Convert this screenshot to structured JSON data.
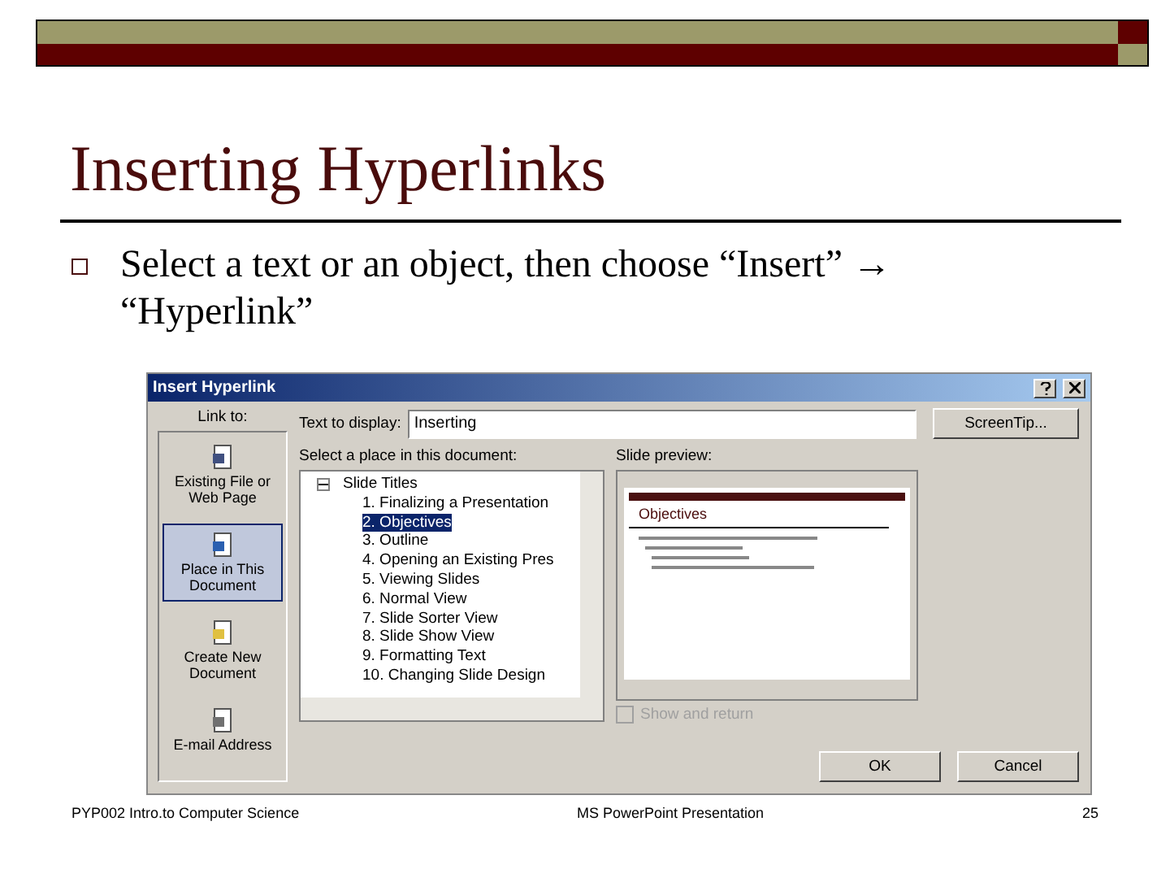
{
  "slide": {
    "title": "Inserting Hyperlinks",
    "bullets": [
      "Select a text or an object, then choose “Insert” → “Hyperlink”"
    ],
    "dialog": {
      "title": "Insert Hyperlink",
      "link_to_label": "Link to:",
      "link_to": [
        {
          "label": "Existing File or Web Page",
          "selected": false,
          "kind": "file"
        },
        {
          "label": "Place in This Document",
          "selected": true,
          "kind": "place"
        },
        {
          "label": "Create New Document",
          "selected": false,
          "kind": "new"
        },
        {
          "label": "E-mail Address",
          "selected": false,
          "kind": "mail"
        }
      ],
      "text_to_display_label": "Text to display:",
      "text_to_display": "Inserting",
      "screentip_button": "ScreenTip...",
      "tree_label": "Select a place in this document:",
      "tree": {
        "label": "Slide Titles",
        "expanded": true,
        "children": [
          {
            "label": "1. Finalizing a Presentation",
            "selected": false
          },
          {
            "label": "2. Objectives",
            "selected": true
          },
          {
            "label": "3. Outline",
            "selected": false
          },
          {
            "label": "4. Opening an Existing Pres",
            "selected": false
          },
          {
            "label": "5. Viewing Slides",
            "selected": false
          },
          {
            "label": "6. Normal View",
            "selected": false
          },
          {
            "label": "7. Slide Sorter View",
            "selected": false
          },
          {
            "label": "8. Slide Show View",
            "selected": false
          },
          {
            "label": "9. Formatting Text",
            "selected": false
          },
          {
            "label": "10. Changing Slide Design",
            "selected": false
          }
        ]
      },
      "preview_label": "Slide preview:",
      "preview_title": "Objectives",
      "show_and_return": {
        "label": "Show and return",
        "checked": false,
        "disabled": true
      },
      "buttons": [
        "OK",
        "Cancel"
      ]
    },
    "footer": {
      "left": "PYP002 Intro.to Computer Science",
      "center": "MS PowerPoint Presentation",
      "page": "25"
    }
  }
}
